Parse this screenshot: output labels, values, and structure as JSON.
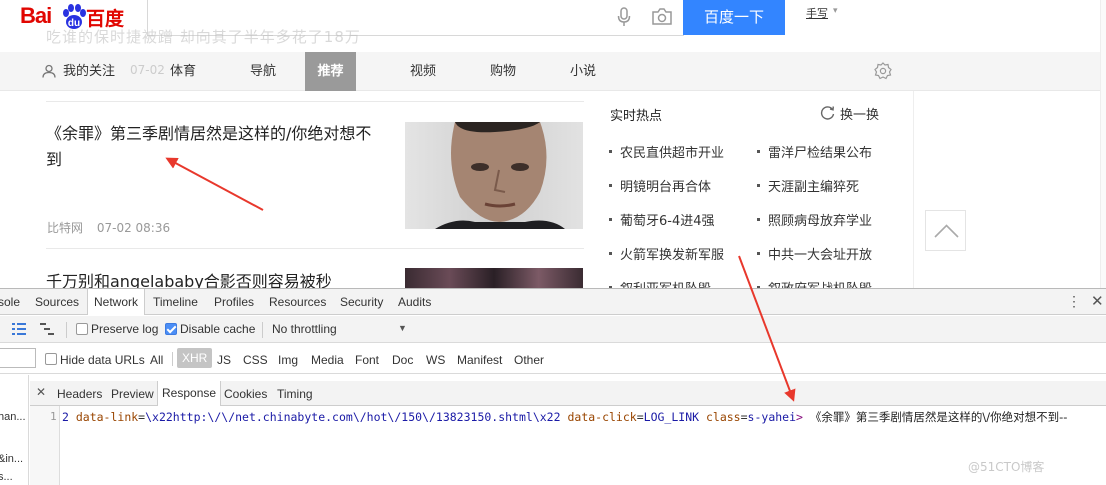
{
  "header": {
    "logo_text": "Baidu百度",
    "search_button_label": "百度一下",
    "handwrite_label": "手写",
    "blurred_headline": "吃谁的保时捷被蹭 却向其了半年多花了18万"
  },
  "nav": {
    "my_follow": "我的关注",
    "ghost_time": "07-02",
    "items": [
      "体育",
      "导航",
      "推荐",
      "视频",
      "购物",
      "小说"
    ],
    "active": "推荐"
  },
  "articles": [
    {
      "title": "《余罪》第三季剧情居然是这样的/你绝对想不到",
      "source": "比特网",
      "time": "07-02 08:36"
    },
    {
      "title": "千万别和angelababy合影否则容易被秒"
    }
  ],
  "hot": {
    "title": "实时热点",
    "refresh_label": "换一换",
    "left": [
      "农民直供超市开业",
      "明镜明台再合体",
      "葡萄牙6-4进4强",
      "火箭军换发新军服",
      "叙利亚军机坠毁"
    ],
    "right": [
      "雷洋尸检结果公布",
      "天涯副主编猝死",
      "照顾病母放弃学业",
      "中共一大会址开放",
      "叙政府军战机坠毁"
    ]
  },
  "devtools": {
    "tabs": [
      "sole",
      "Sources",
      "Network",
      "Timeline",
      "Profiles",
      "Resources",
      "Security",
      "Audits"
    ],
    "active_tab": "Network",
    "toolbar": {
      "preserve_log": "Preserve log",
      "disable_cache": "Disable cache",
      "throttling": "No throttling"
    },
    "filter": {
      "hide_data_urls": "Hide data URLs",
      "types": [
        "All",
        "XHR",
        "JS",
        "CSS",
        "Img",
        "Media",
        "Font",
        "Doc",
        "WS",
        "Manifest",
        "Other"
      ],
      "active_type": "XHR"
    },
    "sidebar_rows": [
      "han...",
      "",
      "&in...",
      "s..."
    ],
    "subtabs": [
      "Headers",
      "Preview",
      "Response",
      "Cookies",
      "Timing"
    ],
    "active_subtab": "Response",
    "response": {
      "line_no": "1",
      "prefix": "2 ",
      "attr1": "data-link",
      "eq": "=",
      "val1": "\\x22http:\\/\\/net.chinabyte.com\\/hot\\/150\\/13823150.shtml\\x22",
      "attr2": "data-click",
      "val2": "LOG_LINK",
      "attr3": "class",
      "val3": "s-yahei",
      "tag_end": ">",
      "text": "《余罪》第三季剧情居然是这样的\\/你绝对想不到--"
    }
  },
  "watermark": "@51CTO博客",
  "colors": {
    "baidu_red": "#e10601",
    "baidu_blue": "#3385ff",
    "arrow_red": "#e8382c",
    "nav_active_bg": "#9a9a9a"
  }
}
